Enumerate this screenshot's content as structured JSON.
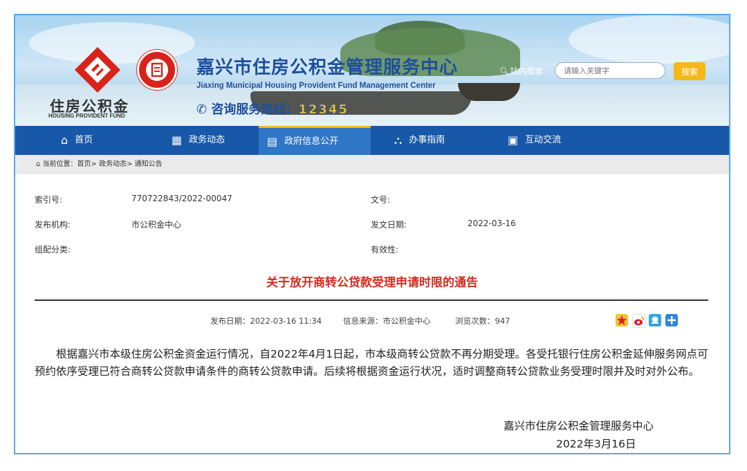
{
  "header": {
    "logo_text": "住房公积金",
    "logo_sub": "HOUSING PROVIDENT FUND",
    "site_title": "嘉兴市住房公积金管理服务中心",
    "site_title_en": "Jiaxing Municipal Housing Provident Fund Management Center",
    "hotline_label": "咨询服务热线：",
    "hotline_number": "12345",
    "search_label": "站内搜索:",
    "search_placeholder": "请输入关键字",
    "search_button": "搜索"
  },
  "nav": {
    "items": [
      {
        "label": "首页",
        "icon": "home-icon"
      },
      {
        "label": "政务动态",
        "icon": "grid-icon"
      },
      {
        "label": "政府信息公开",
        "icon": "monitor-icon",
        "active": true
      },
      {
        "label": "办事指南",
        "icon": "guide-icon"
      },
      {
        "label": "互动交流",
        "icon": "document-icon"
      }
    ]
  },
  "breadcrumb": {
    "text": "当前位置：首页> 政务动态> 通知公告"
  },
  "meta": {
    "index_label": "索引号:",
    "index_value": "770722843/2022-00047",
    "doc_no_label": "文号:",
    "doc_no_value": "",
    "publisher_label": "发布机构:",
    "publisher_value": "市公积金中心",
    "issue_date_label": "发文日期:",
    "issue_date_value": "2022-03-16",
    "category_label": "组配分类:",
    "category_value": "",
    "validity_label": "有效性:",
    "validity_value": ""
  },
  "article": {
    "title": "关于放开商转公贷款受理申请时限的通告",
    "publish_date": "发布日期：2022-03-16 11:34",
    "source": "信息来源：市公积金中心",
    "views": "浏览次数：947",
    "body": "根据嘉兴市本级住房公积金资金运行情况，自2022年4月1日起，市本级商转公贷款不再分期受理。各受托银行住房公积金延伸服务网点可预约依序受理已符合商转公贷款申请条件的商转公贷款申请。后续将根据资金运行状况，适时调整商转公贷款业务受理时限并及时对外公布。",
    "signature": "嘉兴市住房公积金管理服务中心",
    "sign_date": "2022年3月16日"
  },
  "share_icons": [
    "favorite-icon",
    "weibo-icon",
    "qq-icon",
    "more-share-icon"
  ],
  "colors": {
    "nav_bg": "#1758a8",
    "nav_active": "#2f76c7",
    "accent_yellow": "#f6b818",
    "title_red": "#d72a1e",
    "frame_border": "#5aa9e6"
  }
}
